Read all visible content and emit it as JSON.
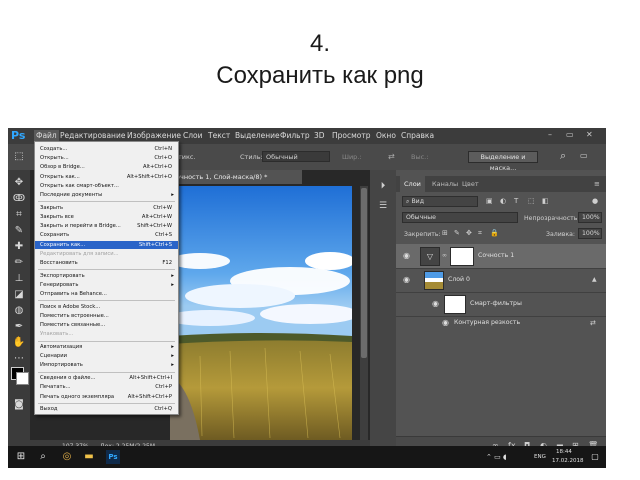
{
  "slide": {
    "number": "4.",
    "title": "Сохранить как png"
  },
  "app": {
    "logo": "Ps",
    "menu": [
      "Файл",
      "Редактирование",
      "Изображение",
      "Слои",
      "Текст",
      "Выделение",
      "Фильтр",
      "3D",
      "Просмотр",
      "Окно",
      "Справка"
    ],
    "window_controls": [
      "–",
      "▭",
      "✕"
    ]
  },
  "options_bar": {
    "mode_suffix": "тикс.",
    "style_label": "Стиль:",
    "style_value": "Обычный",
    "width_label": "Шир.:",
    "height_label": "Выс.:",
    "select_mask_button": "Выделение и маска..."
  },
  "document": {
    "tab_label": "очность 1, Слой-маска/8) *",
    "zoom": "107,37%",
    "doc_size": "Док: 2,25M/2,25M"
  },
  "file_menu": {
    "items": [
      {
        "label": "Создать...",
        "shortcut": "Ctrl+N"
      },
      {
        "label": "Открыть...",
        "shortcut": "Ctrl+O"
      },
      {
        "label": "Обзор в Bridge...",
        "shortcut": "Alt+Ctrl+O"
      },
      {
        "label": "Открыть как...",
        "shortcut": "Alt+Shift+Ctrl+O"
      },
      {
        "label": "Открыть как смарт-объект...",
        "shortcut": ""
      },
      {
        "label": "Последние документы",
        "shortcut": "",
        "submenu": true
      },
      {
        "label": "Закрыть",
        "shortcut": "Ctrl+W"
      },
      {
        "label": "Закрыть все",
        "shortcut": "Alt+Ctrl+W"
      },
      {
        "label": "Закрыть и перейти в Bridge...",
        "shortcut": "Shift+Ctrl+W"
      },
      {
        "label": "Сохранить",
        "shortcut": "Ctrl+S"
      },
      {
        "label": "Сохранить как...",
        "shortcut": "Shift+Ctrl+S",
        "highlighted": true
      },
      {
        "label": "Редактировать для записи...",
        "shortcut": "",
        "disabled": true
      },
      {
        "label": "Восстановить",
        "shortcut": "F12"
      },
      {
        "label": "Экспортировать",
        "shortcut": "",
        "submenu": true
      },
      {
        "label": "Генерировать",
        "shortcut": "",
        "submenu": true
      },
      {
        "label": "Отправить на Behance...",
        "shortcut": ""
      },
      {
        "label": "Поиск в Adobe Stock...",
        "shortcut": ""
      },
      {
        "label": "Поместить встроенные...",
        "shortcut": ""
      },
      {
        "label": "Поместить связанные...",
        "shortcut": ""
      },
      {
        "label": "Упаковать...",
        "shortcut": "",
        "disabled": true
      },
      {
        "label": "Автоматизация",
        "shortcut": "",
        "submenu": true
      },
      {
        "label": "Сценарии",
        "shortcut": "",
        "submenu": true
      },
      {
        "label": "Импортировать",
        "shortcut": "",
        "submenu": true
      },
      {
        "label": "Сведения о файле...",
        "shortcut": "Alt+Shift+Ctrl+I"
      },
      {
        "label": "Печатать...",
        "shortcut": "Ctrl+P"
      },
      {
        "label": "Печать одного экземпляра",
        "shortcut": "Alt+Shift+Ctrl+P"
      },
      {
        "label": "Выход",
        "shortcut": "Ctrl+Q"
      }
    ]
  },
  "layers_panel": {
    "tabs": [
      "Слои",
      "Каналы",
      "Цвет"
    ],
    "filter_kind": "Вид",
    "blend_mode": "Обычные",
    "opacity_label": "Непрозрачность:",
    "opacity_value": "100%",
    "lock_label": "Закрепить:",
    "fill_label": "Заливка:",
    "fill_value": "100%",
    "layers": [
      {
        "name": "Сочность 1"
      },
      {
        "name": "Слой 0"
      },
      {
        "name": "Смарт-фильтры"
      },
      {
        "name": "Контурная резкость"
      }
    ]
  },
  "taskbar": {
    "language": "ENG",
    "time": "18:44",
    "date": "17.02.2018"
  }
}
